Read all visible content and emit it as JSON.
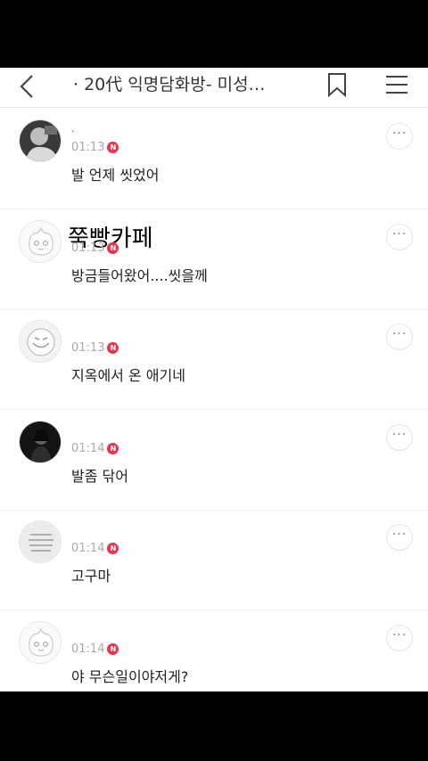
{
  "header": {
    "title": "· 20代 익명담화방- 미성…"
  },
  "messages": [
    {
      "name": ".",
      "time": "01:13",
      "badge": "N",
      "text": "발 언제 씻었어"
    },
    {
      "name": "",
      "time": "01:13",
      "badge": "N",
      "text": "방금들어왔어....씻을께"
    },
    {
      "name": "",
      "time": "01:13",
      "badge": "N",
      "text": "지옥에서 온 애기네"
    },
    {
      "name": "",
      "time": "01:14",
      "badge": "N",
      "text": "발좀 닦어"
    },
    {
      "name": "",
      "time": "01:14",
      "badge": "N",
      "text": "고구마"
    },
    {
      "name": "",
      "time": "01:14",
      "badge": "N",
      "text": "야 무슨일이야저게?"
    }
  ],
  "overlay_text": "쭉빵카페",
  "more_label": "···"
}
